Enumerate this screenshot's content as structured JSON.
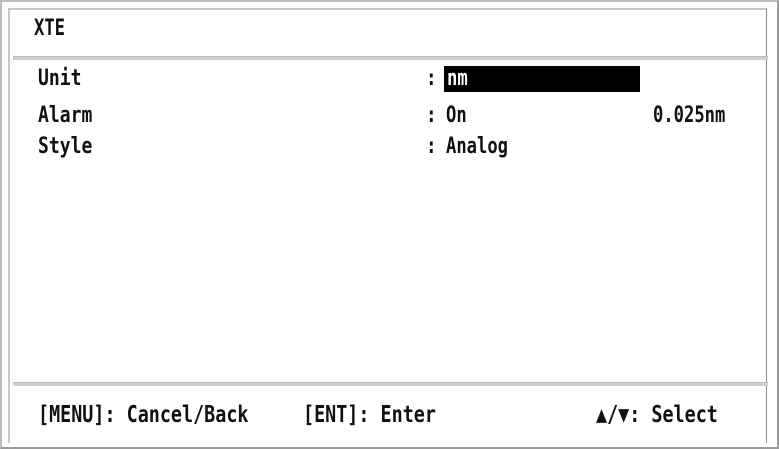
{
  "title": "XTE",
  "settings": [
    {
      "label": "Unit",
      "value": "nm",
      "extra": ""
    },
    {
      "label": "Alarm",
      "value": "On",
      "extra": "0.025nm"
    },
    {
      "label": "Style",
      "value": "Analog",
      "extra": ""
    }
  ],
  "colon": ":",
  "footer": {
    "menu": "[MENU]: Cancel/Back",
    "enter": "[ENT]: Enter",
    "select": "▲/▼: Select"
  }
}
